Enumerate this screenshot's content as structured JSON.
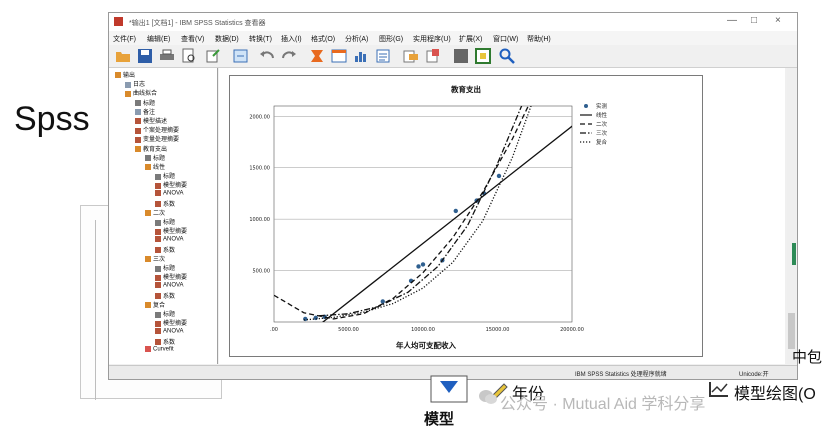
{
  "slide_label": "Spss",
  "window": {
    "title": "*输出1 [文档1] - IBM SPSS Statistics 查看器",
    "controls": [
      "—",
      "□",
      "×"
    ]
  },
  "menu": [
    "文件(F)",
    "编辑(E)",
    "查看(V)",
    "数据(D)",
    "转换(T)",
    "插入(I)",
    "格式(O)",
    "分析(A)",
    "图形(G)",
    "实用程序(U)",
    "扩展(X)",
    "窗口(W)",
    "帮助(H)"
  ],
  "toolbar_icons": [
    "open-folder-icon",
    "save-icon",
    "print-icon",
    "print-preview-icon",
    "export-icon",
    "goto-data-icon",
    "undo-icon",
    "redo-icon",
    "goto-case-icon",
    "goto-variable-icon",
    "variables-icon",
    "insert-output-icon",
    "pivot-icon",
    "promote-icon",
    "demote-icon",
    "select-icon",
    "find-icon"
  ],
  "nav": {
    "items": [
      {
        "label": "输出",
        "indent": 0,
        "icon": "book"
      },
      {
        "label": "日志",
        "indent": 1,
        "icon": "page"
      },
      {
        "label": "曲线拟合",
        "indent": 1,
        "icon": "book"
      },
      {
        "label": "标题",
        "indent": 2,
        "icon": "title"
      },
      {
        "label": "备注",
        "indent": 2,
        "icon": "page"
      },
      {
        "label": "模型描述",
        "indent": 2,
        "icon": "table"
      },
      {
        "label": "个案处理摘要",
        "indent": 2,
        "icon": "table"
      },
      {
        "label": "变量处理摘要",
        "indent": 2,
        "icon": "table"
      },
      {
        "label": "教育支出",
        "indent": 2,
        "icon": "book"
      },
      {
        "label": "标题",
        "indent": 3,
        "icon": "title"
      },
      {
        "label": "线性",
        "indent": 3,
        "icon": "book"
      },
      {
        "label": "标题",
        "indent": 4,
        "icon": "title"
      },
      {
        "label": "模型摘要",
        "indent": 4,
        "icon": "table"
      },
      {
        "label": "ANOVA",
        "indent": 4,
        "icon": "table"
      },
      {
        "label": "系数",
        "indent": 4,
        "icon": "table"
      },
      {
        "label": "二次",
        "indent": 3,
        "icon": "book"
      },
      {
        "label": "标题",
        "indent": 4,
        "icon": "title"
      },
      {
        "label": "模型摘要",
        "indent": 4,
        "icon": "table"
      },
      {
        "label": "ANOVA",
        "indent": 4,
        "icon": "table"
      },
      {
        "label": "系数",
        "indent": 4,
        "icon": "table"
      },
      {
        "label": "三次",
        "indent": 3,
        "icon": "book"
      },
      {
        "label": "标题",
        "indent": 4,
        "icon": "title"
      },
      {
        "label": "模型摘要",
        "indent": 4,
        "icon": "table"
      },
      {
        "label": "ANOVA",
        "indent": 4,
        "icon": "table"
      },
      {
        "label": "系数",
        "indent": 4,
        "icon": "table"
      },
      {
        "label": "复合",
        "indent": 3,
        "icon": "book"
      },
      {
        "label": "标题",
        "indent": 4,
        "icon": "title"
      },
      {
        "label": "模型摘要",
        "indent": 4,
        "icon": "table"
      },
      {
        "label": "ANOVA",
        "indent": 4,
        "icon": "table"
      },
      {
        "label": "系数",
        "indent": 4,
        "icon": "table"
      },
      {
        "label": "Curvefit",
        "indent": 3,
        "icon": "chart"
      }
    ]
  },
  "status": {
    "processor": "IBM SPSS Statistics 处理程序就绪",
    "unicode": "Unicode:开"
  },
  "bottom": {
    "year_label": "年份",
    "model_plot": "模型绘图(O",
    "center_pkg": "中包",
    "model_frag": "模型"
  },
  "watermark": "公众号 · Mutual Aid 学科分享",
  "chart_data": {
    "type": "scatter",
    "title": "教育支出",
    "xlabel": "年人均可支配收入",
    "ylabel": "",
    "xlim": [
      0,
      20000
    ],
    "ylim": [
      0,
      2100
    ],
    "xticks": [
      0,
      5000,
      10000,
      15000,
      20000
    ],
    "xtick_labels": [
      ".00",
      "5000.00",
      "10000.00",
      "15000.00",
      "20000.00"
    ],
    "yticks": [
      500,
      1000,
      1500,
      2000
    ],
    "ytick_labels": [
      "500.00",
      "1000.00",
      "1500.00",
      "2000.00"
    ],
    "grid": "horizontal",
    "legend_position": "top-right",
    "legend": [
      "实测",
      "线性",
      "二次",
      "三次",
      "复合"
    ],
    "series": [
      {
        "name": "实测",
        "kind": "points",
        "x": [
          2100,
          2800,
          3400,
          7300,
          9200,
          9700,
          10000,
          11300,
          12200,
          13600,
          14100,
          15100
        ],
        "y": [
          30,
          40,
          50,
          200,
          400,
          540,
          560,
          600,
          1080,
          1180,
          1250,
          1420
        ]
      },
      {
        "name": "线性",
        "kind": "line",
        "style": "solid",
        "x": [
          3200,
          20500
        ],
        "y": [
          -10,
          1960
        ]
      },
      {
        "name": "二次",
        "kind": "line",
        "style": "dashed",
        "x": [
          0,
          2000,
          4000,
          6000,
          8000,
          10000,
          12000,
          14000,
          16000,
          18000
        ],
        "y": [
          260,
          90,
          30,
          80,
          230,
          480,
          820,
          1260,
          1780,
          2380
        ]
      },
      {
        "name": "三次",
        "kind": "line",
        "style": "dashdot",
        "x": [
          3000,
          5000,
          7000,
          9000,
          11000,
          13000,
          15000,
          16500,
          17500
        ],
        "y": [
          60,
          80,
          150,
          290,
          540,
          940,
          1540,
          2060,
          2400
        ]
      },
      {
        "name": "复合",
        "kind": "line",
        "style": "dotted",
        "x": [
          2000,
          4000,
          6000,
          8000,
          10000,
          12000,
          14000,
          16000,
          17500
        ],
        "y": [
          20,
          45,
          95,
          180,
          330,
          580,
          980,
          1600,
          2200
        ]
      }
    ]
  }
}
